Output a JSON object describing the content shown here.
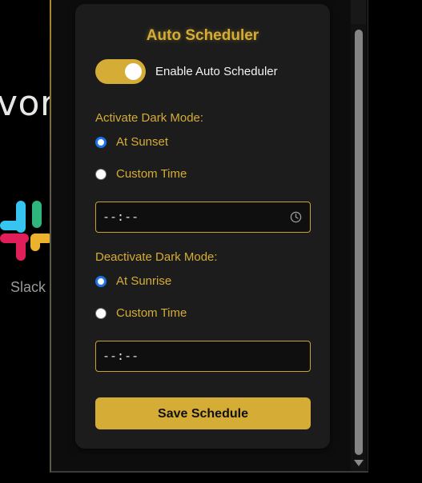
{
  "background": {
    "heading_fragment": "vori",
    "app_label": "Slack",
    "logo_icon": "slack-logo-icon"
  },
  "popup": {
    "title": "Auto Scheduler",
    "enable_toggle": {
      "label": "Enable Auto Scheduler",
      "on": true
    },
    "activate": {
      "label": "Activate Dark Mode:",
      "options": [
        {
          "label": "At Sunset",
          "checked": true
        },
        {
          "label": "Custom Time",
          "checked": false
        }
      ],
      "time_value": "--:--"
    },
    "deactivate": {
      "label": "Deactivate Dark Mode:",
      "options": [
        {
          "label": "At Sunrise",
          "checked": true
        },
        {
          "label": "Custom Time",
          "checked": false
        }
      ],
      "time_value": "--:--"
    },
    "save_label": "Save Schedule"
  },
  "colors": {
    "accent": "#d4ac36",
    "card": "#1c1c1c",
    "radio_selected": "#1a73e8"
  },
  "icons": [
    "clock-icon",
    "chevron-down-icon"
  ]
}
